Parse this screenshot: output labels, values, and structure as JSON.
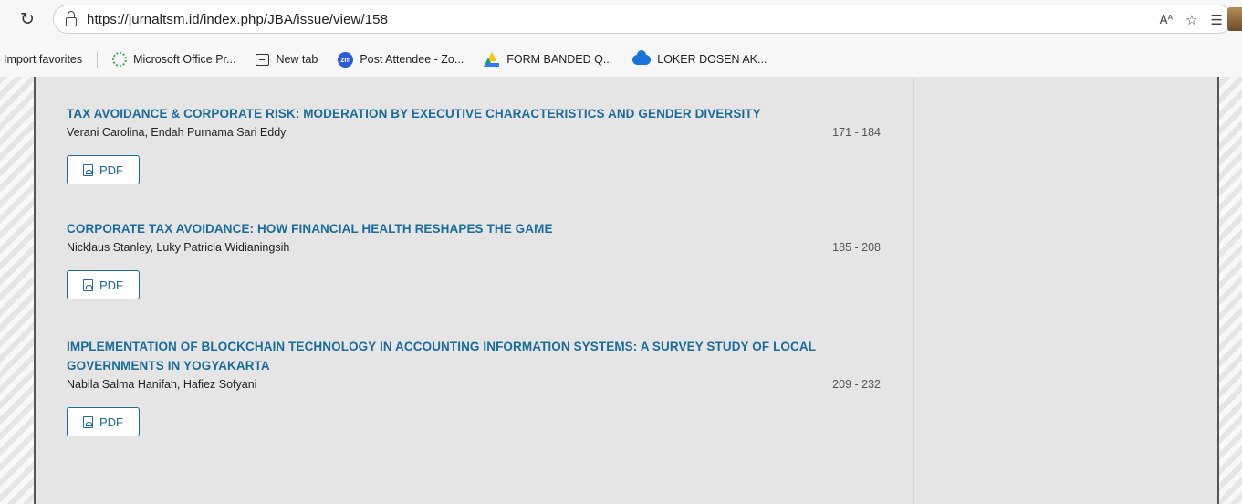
{
  "browser": {
    "url": "https://jurnaltsm.id/index.php/JBA/issue/view/158",
    "readaloud_label": "Aᴬ",
    "bookmarks": [
      {
        "label": "Import favorites",
        "icon": "folder-icon"
      },
      {
        "label": "Microsoft Office Pr...",
        "icon": "microsoft-office-icon"
      },
      {
        "label": "New tab",
        "icon": "new-tab-icon"
      },
      {
        "label": "Post Attendee - Zo...",
        "icon": "zoom-icon",
        "icon_text": "zm"
      },
      {
        "label": "FORM BANDED Q...",
        "icon": "google-drive-icon"
      },
      {
        "label": "LOKER DOSEN AK...",
        "icon": "onedrive-cloud-icon"
      }
    ]
  },
  "articles": [
    {
      "title": "TAX AVOIDANCE & CORPORATE RISK: MODERATION BY EXECUTIVE CHARACTERISTICS AND GENDER DIVERSITY",
      "authors": "Verani Carolina, Endah Purnama Sari Eddy",
      "pages": "171 - 184",
      "pdf_label": "PDF"
    },
    {
      "title": "CORPORATE TAX AVOIDANCE: HOW FINANCIAL HEALTH RESHAPES THE GAME",
      "authors": "Nicklaus Stanley, Luky Patricia Widianingsih",
      "pages": "185 - 208",
      "pdf_label": "PDF"
    },
    {
      "title": "IMPLEMENTATION OF BLOCKCHAIN TECHNOLOGY IN ACCOUNTING INFORMATION SYSTEMS: A SURVEY STUDY OF LOCAL GOVERNMENTS IN YOGYAKARTA",
      "authors": "Nabila Salma Hanifah, Hafiez Sofyani",
      "pages": "209 - 232",
      "pdf_label": "PDF"
    }
  ],
  "colors": {
    "link": "#1a6c9a",
    "page_bg": "#e5e5e5"
  }
}
